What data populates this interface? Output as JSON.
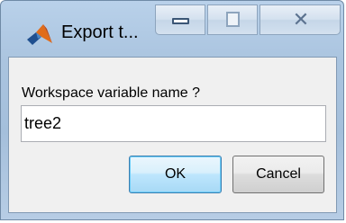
{
  "window": {
    "title": "Export t...",
    "minimize_glyph_name": "minimize-icon",
    "maximize_glyph_name": "maximize-icon",
    "close_glyph": "✕"
  },
  "dialog": {
    "prompt": "Workspace variable name ?",
    "variable_value": "tree2",
    "ok_label": "OK",
    "cancel_label": "Cancel"
  },
  "colors": {
    "title_bar": "#aac4df",
    "client_bg": "#f0f0f0",
    "ok_border": "#3c7fb1",
    "matlab_orange": "#e06c1b",
    "matlab_blue": "#1f4f8f"
  }
}
